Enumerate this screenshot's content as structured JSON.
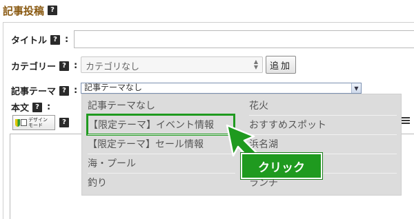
{
  "section": {
    "title": "記事投稿",
    "help": "?"
  },
  "form": {
    "title_label": "タイトル",
    "category_label": "カテゴリー",
    "category_value": "カテゴリなし",
    "add_button": "追加",
    "theme_label": "記事テーマ",
    "theme_value": "記事テーマなし",
    "body_label": "本文",
    "colon": ":",
    "help": "?"
  },
  "toolbar": {
    "design_mode": "デザイン\nモード"
  },
  "dropdown": {
    "col1": [
      "記事テーマなし",
      "【限定テーマ】イベント情報",
      "【限定テーマ】セール情報",
      "海・プール",
      "釣り"
    ],
    "col2": [
      "花火",
      "おすすめスポット",
      "浜名湖",
      "",
      "ランチ"
    ],
    "highlighted": "【限定テーマ】イベント情報"
  },
  "callout": {
    "label": "クリック",
    "color": "#1f9a1f"
  },
  "icons": [
    "help-icon",
    "leaf-icon",
    "checkbox-icon",
    "cursor-arrow-icon",
    "justify-icon"
  ]
}
